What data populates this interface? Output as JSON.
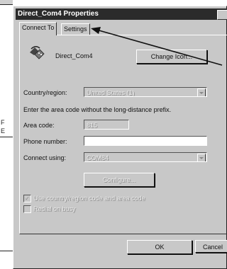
{
  "background": {
    "letters": [
      "F",
      "E"
    ]
  },
  "window": {
    "title": "Direct_Com4 Properties"
  },
  "tabs": [
    {
      "label": "Connect To",
      "active": true
    },
    {
      "label": "Settings",
      "active": false
    }
  ],
  "connection": {
    "icon": "phone-modem-icon",
    "name": "Direct_Com4",
    "change_icon_label": "Change Icon..."
  },
  "country": {
    "label": "Country/region:",
    "value": "United States (1)"
  },
  "instruction": "Enter the area code without the long-distance prefix.",
  "area_code": {
    "label": "Area code:",
    "value": "815"
  },
  "phone_number": {
    "label": "Phone number:",
    "value": ""
  },
  "connect_using": {
    "label": "Connect using:",
    "value": "COM84"
  },
  "configure_label": "Configure...",
  "options": [
    {
      "label": "Use country/region code and area code",
      "checked": true
    },
    {
      "label": "Redial on busy",
      "checked": false
    }
  ],
  "footer": {
    "ok_label": "OK",
    "cancel_label": "Cancel"
  },
  "colors": {
    "dialog_face": "#c8c8c8",
    "title_bar": "#2b2b2b",
    "disabled_text": "#e8e8e8"
  }
}
